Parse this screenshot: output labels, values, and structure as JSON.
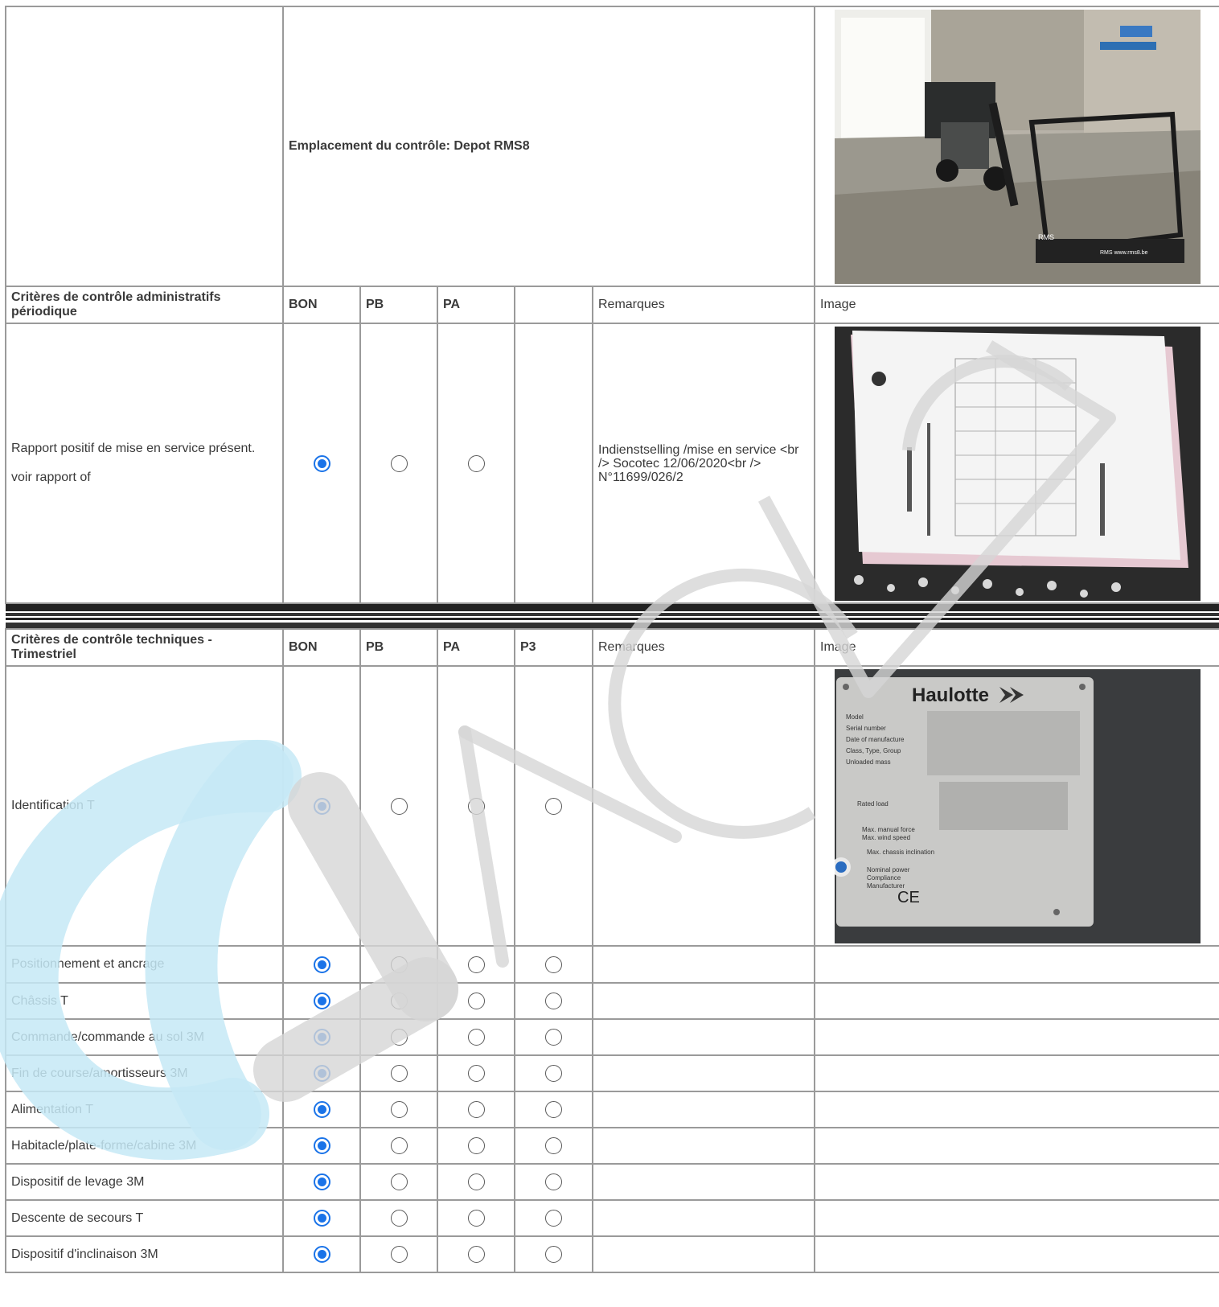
{
  "location": "Emplacement du contrôle: Depot RMS8",
  "admin": {
    "headers": [
      "Critères de contrôle administratifs périodique",
      "BON",
      "PB",
      "PA",
      "",
      "Remarques",
      "Image"
    ],
    "row": {
      "line1": "Rapport positif de mise en service présent.",
      "line2": "voir rapport of",
      "radios": [
        "on",
        "off",
        "off"
      ],
      "remark": "Indienstselling /mise en service <br /> Socotec 12/06/2020<br /> N°11699/026/2"
    }
  },
  "tech": {
    "headers": [
      "Critères de contrôle techniques - Trimestriel",
      "BON",
      "PB",
      "PA",
      "P3",
      "Remarques",
      "Image"
    ],
    "plate": {
      "brand": "Haulotte",
      "labels": [
        "Model",
        "Serial number",
        "Date of manufacture",
        "Class, Type, Group",
        "Unloaded mass",
        "Rated load",
        "Max. manual force",
        "Max. wind speed",
        "Max. chassis inclination",
        "Nominal power",
        "Compliance",
        "Manufacturer"
      ],
      "ce": "CE"
    },
    "photo_text": {
      "rms": "RMS",
      "rms2": "RMS www.rms8.be"
    },
    "rows": [
      {
        "label": "Identification T",
        "radios": [
          "on",
          "off",
          "off",
          "off"
        ]
      },
      {
        "label": "Positionnement et ancrage",
        "radios": [
          "on",
          "off",
          "off",
          "off"
        ]
      },
      {
        "label": "Châssis T",
        "radios": [
          "on",
          "off",
          "off",
          "off"
        ]
      },
      {
        "label": "Commande/commande au sol 3M",
        "radios": [
          "on",
          "off",
          "off",
          "off"
        ]
      },
      {
        "label": "Fin de course/amortisseurs 3M",
        "radios": [
          "on",
          "off",
          "off",
          "off"
        ]
      },
      {
        "label": "Alimentation T",
        "radios": [
          "on",
          "off",
          "off",
          "off"
        ]
      },
      {
        "label": "Habitacle/plate-forme/cabine 3M",
        "radios": [
          "on",
          "off",
          "off",
          "off"
        ]
      },
      {
        "label": "Dispositif de levage 3M",
        "radios": [
          "on",
          "off",
          "off",
          "off"
        ]
      },
      {
        "label": "Descente de secours T",
        "radios": [
          "on",
          "off",
          "off",
          "off"
        ]
      },
      {
        "label": "Dispositif d'inclinaison 3M",
        "radios": [
          "on",
          "off",
          "off",
          "off"
        ]
      }
    ]
  },
  "colors": {
    "radio_on": "#1a73e8",
    "border": "#9a9a9a",
    "wm_blue": "#c6e9f6",
    "wm_gray": "#d6d6d6"
  }
}
